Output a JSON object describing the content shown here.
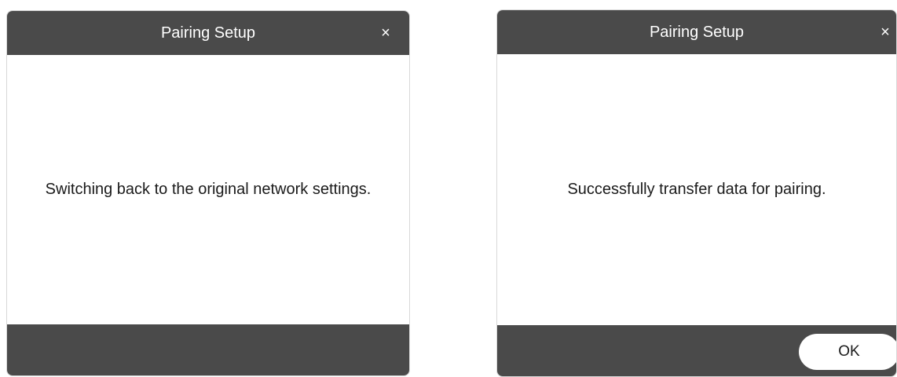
{
  "dialogs": [
    {
      "title": "Pairing Setup",
      "close_icon": "×",
      "message": "Switching back to the original network settings."
    },
    {
      "title": "Pairing Setup",
      "close_icon": "×",
      "message": "Successfully transfer data for pairing.",
      "ok_label": "OK"
    }
  ],
  "colors": {
    "header_bg": "#4a4a4a",
    "footer_bg": "#4a4a4a",
    "body_bg": "#ffffff",
    "button_bg": "#ffffff"
  }
}
